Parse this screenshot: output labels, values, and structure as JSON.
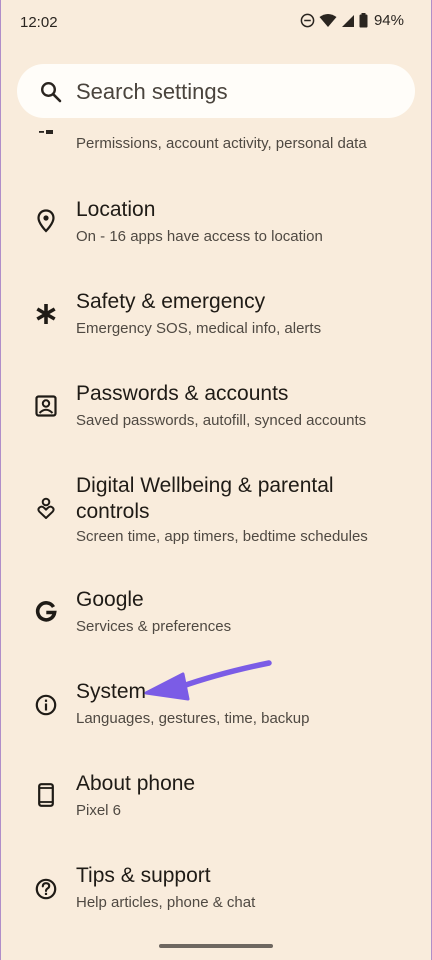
{
  "status_bar": {
    "time": "12:02",
    "battery": "94%"
  },
  "search": {
    "placeholder": "Search settings"
  },
  "partial_item": {
    "subtitle": "Permissions, account activity, personal data"
  },
  "items": [
    {
      "title": "Location",
      "subtitle": "On - 16 apps have access to location",
      "icon": "location-pin-icon"
    },
    {
      "title": "Safety & emergency",
      "subtitle": "Emergency SOS, medical info, alerts",
      "icon": "asterisk-icon"
    },
    {
      "title": "Passwords & accounts",
      "subtitle": "Saved passwords, autofill, synced accounts",
      "icon": "account-box-icon"
    },
    {
      "title_line1": "Digital Wellbeing & parental",
      "title_line2": "controls",
      "subtitle": "Screen time, app timers, bedtime schedules",
      "icon": "wellbeing-icon"
    },
    {
      "title": "Google",
      "subtitle": "Services & preferences",
      "icon": "google-g-icon"
    },
    {
      "title": "System",
      "subtitle": "Languages, gestures, time, backup",
      "icon": "info-icon"
    },
    {
      "title": "About phone",
      "subtitle": "Pixel 6",
      "icon": "phone-icon"
    },
    {
      "title": "Tips & support",
      "subtitle": "Help articles, phone & chat",
      "icon": "help-icon"
    }
  ],
  "colors": {
    "background": "#f9ecdc",
    "search_bg": "#fffdf9",
    "arrow": "#7b5ce6"
  }
}
